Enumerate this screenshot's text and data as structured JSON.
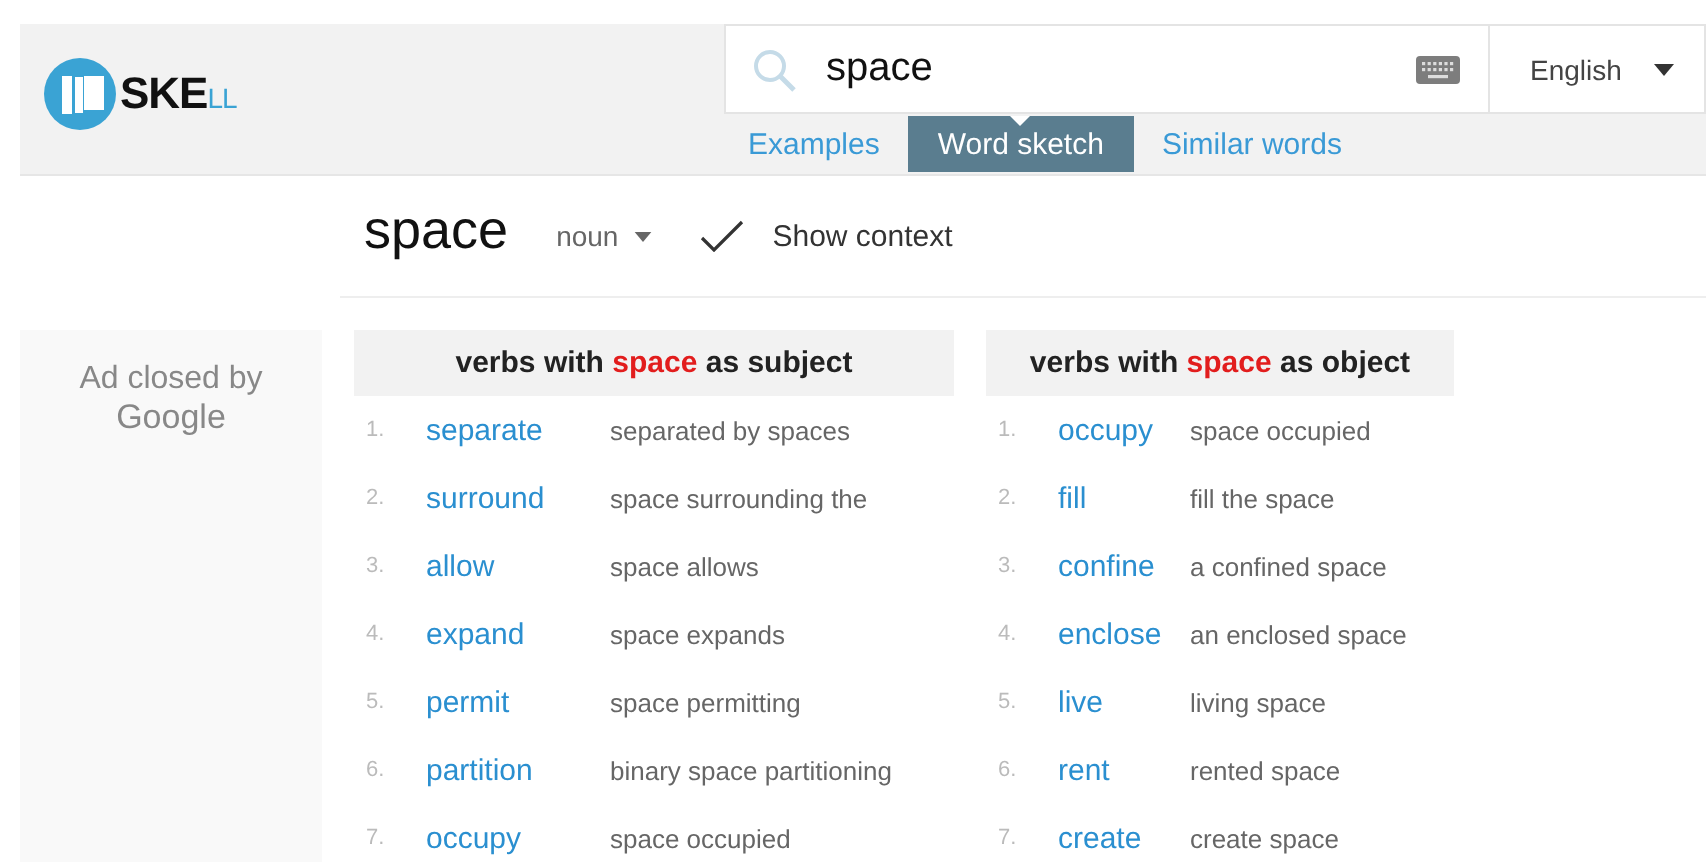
{
  "logo": {
    "main": "SKE",
    "tail": "LL"
  },
  "search": {
    "value": "space"
  },
  "language": {
    "label": "English"
  },
  "tabs": [
    {
      "label": "Examples",
      "selected": false
    },
    {
      "label": "Word sketch",
      "selected": true
    },
    {
      "label": "Similar words",
      "selected": false
    }
  ],
  "headword": {
    "word": "space",
    "pos": "noun",
    "show_context": true,
    "show_context_label": "Show context"
  },
  "ad": {
    "line1": "Ad closed by",
    "line2": "Google"
  },
  "columns": [
    {
      "title": {
        "before": "verbs with",
        "highlight": "space",
        "after": "as subject"
      },
      "items": [
        {
          "number": "1.",
          "word": "separate",
          "example": "separated by spaces"
        },
        {
          "number": "2.",
          "word": "surround",
          "example": "space surrounding the"
        },
        {
          "number": "3.",
          "word": "allow",
          "example": "space allows"
        },
        {
          "number": "4.",
          "word": "expand",
          "example": "space expands"
        },
        {
          "number": "5.",
          "word": "permit",
          "example": "space permitting"
        },
        {
          "number": "6.",
          "word": "partition",
          "example": "binary space partitioning"
        },
        {
          "number": "7.",
          "word": "occupy",
          "example": "space occupied"
        }
      ]
    },
    {
      "title": {
        "before": "verbs with",
        "highlight": "space",
        "after": "as object"
      },
      "items": [
        {
          "number": "1.",
          "word": "occupy",
          "example": "space occupied"
        },
        {
          "number": "2.",
          "word": "fill",
          "example": "fill the space"
        },
        {
          "number": "3.",
          "word": "confine",
          "example": "a confined space"
        },
        {
          "number": "4.",
          "word": "enclose",
          "example": "an enclosed space"
        },
        {
          "number": "5.",
          "word": "live",
          "example": "living space"
        },
        {
          "number": "6.",
          "word": "rent",
          "example": "rented space"
        },
        {
          "number": "7.",
          "word": "create",
          "example": "create space"
        }
      ]
    }
  ]
}
